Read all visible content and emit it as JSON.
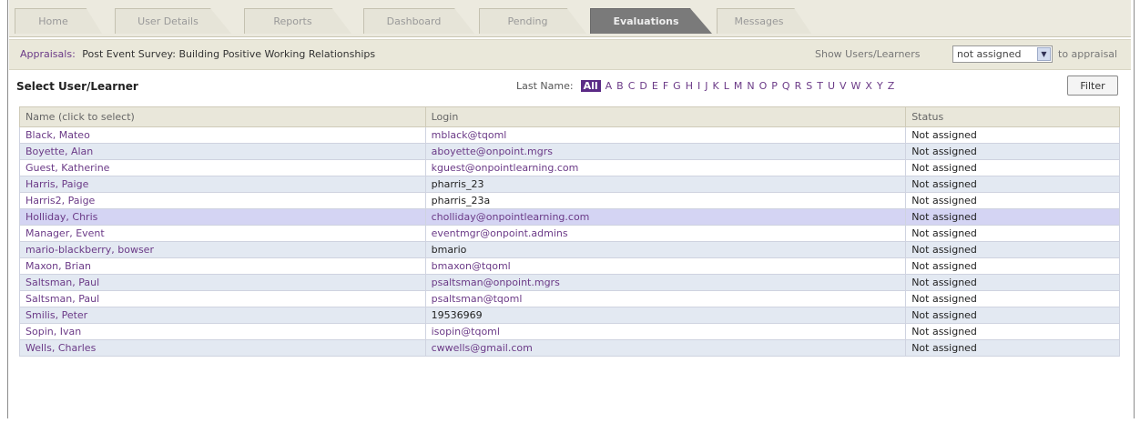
{
  "tabs": [
    {
      "label": "Home",
      "active": false
    },
    {
      "label": "User Details",
      "active": false
    },
    {
      "label": "Reports",
      "active": false
    },
    {
      "label": "Dashboard",
      "active": false
    },
    {
      "label": "Pending",
      "active": false
    },
    {
      "label": "Evaluations",
      "active": true
    },
    {
      "label": "Messages",
      "active": false
    }
  ],
  "appraisal": {
    "label": "Appraisals:",
    "value": "Post Event Survey: Building Positive Working Relationships",
    "show_users_label": "Show Users/Learners",
    "filter_value": "not assigned",
    "suffix": "to appraisal"
  },
  "section": {
    "title": "Select User/Learner",
    "last_name_label": "Last Name:",
    "letters": [
      "All",
      "A",
      "B",
      "C",
      "D",
      "E",
      "F",
      "G",
      "H",
      "I",
      "J",
      "K",
      "L",
      "M",
      "N",
      "O",
      "P",
      "Q",
      "R",
      "S",
      "T",
      "U",
      "V",
      "W",
      "X",
      "Y",
      "Z"
    ],
    "filter_button": "Filter"
  },
  "table": {
    "columns": [
      "Name (click to select)",
      "Login",
      "Status"
    ],
    "rows": [
      {
        "name": "Black, Mateo",
        "login": "mblack@tqoml",
        "status": "Not assigned",
        "login_link": true
      },
      {
        "name": "Boyette, Alan",
        "login": "aboyette@onpoint.mgrs",
        "status": "Not assigned",
        "login_link": true
      },
      {
        "name": "Guest, Katherine",
        "login": "kguest@onpointlearning.com",
        "status": "Not assigned",
        "login_link": true
      },
      {
        "name": "Harris, Paige",
        "login": "pharris_23",
        "status": "Not assigned",
        "login_link": false
      },
      {
        "name": "Harris2, Paige",
        "login": "pharris_23a",
        "status": "Not assigned",
        "login_link": false
      },
      {
        "name": "Holliday, Chris",
        "login": "cholliday@onpointlearning.com",
        "status": "Not assigned",
        "login_link": true,
        "highlighted": true
      },
      {
        "name": "Manager, Event",
        "login": "eventmgr@onpoint.admins",
        "status": "Not assigned",
        "login_link": true
      },
      {
        "name": "mario-blackberry, bowser",
        "login": "bmario",
        "status": "Not assigned",
        "login_link": false
      },
      {
        "name": "Maxon, Brian",
        "login": "bmaxon@tqoml",
        "status": "Not assigned",
        "login_link": true
      },
      {
        "name": "Saltsman, Paul",
        "login": "psaltsman@onpoint.mgrs",
        "status": "Not assigned",
        "login_link": true
      },
      {
        "name": "Saltsman, Paul",
        "login": "psaltsman@tqoml",
        "status": "Not assigned",
        "login_link": true
      },
      {
        "name": "Smilis, Peter",
        "login": "19536969",
        "status": "Not assigned",
        "login_link": false
      },
      {
        "name": "Sopin, Ivan",
        "login": "isopin@tqoml",
        "status": "Not assigned",
        "login_link": true
      },
      {
        "name": "Wells, Charles",
        "login": "cwwells@gmail.com",
        "status": "Not assigned",
        "login_link": true
      }
    ]
  }
}
